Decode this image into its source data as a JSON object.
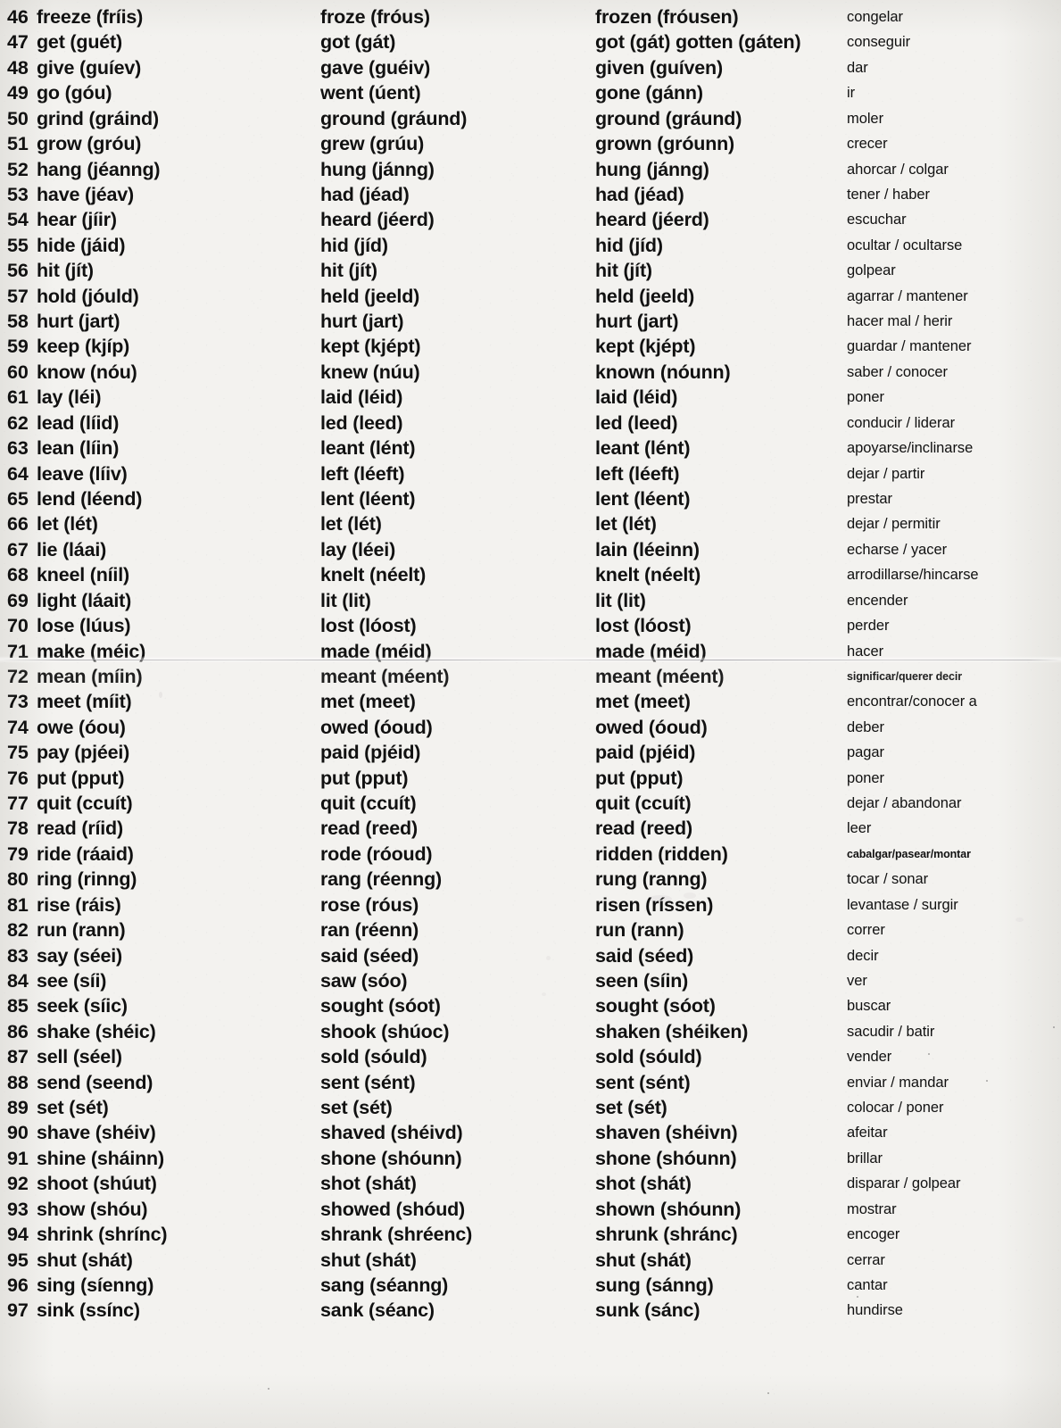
{
  "document": {
    "kind": "scanned-page",
    "title": "Irregular Verbs List (46-97)",
    "columns": [
      "infinitive",
      "past_simple",
      "past_participle",
      "spanish"
    ]
  },
  "rows": [
    {
      "n": "46",
      "inf": "freeze (fríis)",
      "past": "froze (fróus)",
      "part": "frozen (fróusen)",
      "es": "congelar"
    },
    {
      "n": "47",
      "inf": "get (guét)",
      "past": "got (gát)",
      "part": "got (gát) gotten (gáten)",
      "es": "conseguir"
    },
    {
      "n": "48",
      "inf": "give (guíev)",
      "past": "gave (guéiv)",
      "part": "given (guíven)",
      "es": "dar"
    },
    {
      "n": "49",
      "inf": "go (góu)",
      "past": "went (úent)",
      "part": "gone (gánn)",
      "es": "ir"
    },
    {
      "n": "50",
      "inf": "grind (gráind)",
      "past": "ground (gráund)",
      "part": "ground (gráund)",
      "es": "moler"
    },
    {
      "n": "51",
      "inf": "grow (gróu)",
      "past": "grew (grúu)",
      "part": "grown (gróunn)",
      "es": "crecer"
    },
    {
      "n": "52",
      "inf": "hang (jéanng)",
      "past": "hung (jánng)",
      "part": "hung (jánng)",
      "es": "ahorcar / colgar"
    },
    {
      "n": "53",
      "inf": "have (jéav)",
      "past": "had (jéad)",
      "part": "had (jéad)",
      "es": "tener / haber"
    },
    {
      "n": "54",
      "inf": "hear (jíir)",
      "past": "heard (jéerd)",
      "part": "heard (jéerd)",
      "es": "escuchar"
    },
    {
      "n": "55",
      "inf": "hide (jáid)",
      "past": "hid (jíd)",
      "part": "hid (jíd)",
      "es": "ocultar / ocultarse"
    },
    {
      "n": "56",
      "inf": "hit (jít)",
      "past": "hit (jít)",
      "part": "hit (jít)",
      "es": "golpear"
    },
    {
      "n": "57",
      "inf": "hold (jóuld)",
      "past": "held (jeeld)",
      "part": "held (jeeld)",
      "es": "agarrar / mantener"
    },
    {
      "n": "58",
      "inf": "hurt (jart)",
      "past": "hurt (jart)",
      "part": "hurt (jart)",
      "es": "hacer mal / herir"
    },
    {
      "n": "59",
      "inf": "keep (kjíp)",
      "past": "kept (kjépt)",
      "part": "kept (kjépt)",
      "es": "guardar / mantener"
    },
    {
      "n": "60",
      "inf": "know (nóu)",
      "past": "knew (núu)",
      "part": "known (nóunn)",
      "es": "saber / conocer"
    },
    {
      "n": "61",
      "inf": "lay (léi)",
      "past": "laid (léid)",
      "part": "laid (léid)",
      "es": "poner"
    },
    {
      "n": "62",
      "inf": "lead (líid)",
      "past": "led (leed)",
      "part": "led (leed)",
      "es": "conducir / liderar"
    },
    {
      "n": "63",
      "inf": "lean (líin)",
      "past": "leant (lént)",
      "part": "leant (lént)",
      "es": "apoyarse/inclinarse"
    },
    {
      "n": "64",
      "inf": "leave (líiv)",
      "past": "left (léeft)",
      "part": "left (léeft)",
      "es": "dejar / partir"
    },
    {
      "n": "65",
      "inf": "lend (léend)",
      "past": "lent (léent)",
      "part": "lent (léent)",
      "es": "prestar"
    },
    {
      "n": "66",
      "inf": "let (lét)",
      "past": "let (lét)",
      "part": "let (lét)",
      "es": "dejar / permitir"
    },
    {
      "n": "67",
      "inf": "lie (láai)",
      "past": "lay (léei)",
      "part": "lain (léeinn)",
      "es": "echarse / yacer"
    },
    {
      "n": "68",
      "inf": "kneel (níil)",
      "past": "knelt (néelt)",
      "part": "knelt (néelt)",
      "es": "arrodillarse/hincarse"
    },
    {
      "n": "69",
      "inf": "light (láait)",
      "past": "lit (lit)",
      "part": "lit (lit)",
      "es": "encender"
    },
    {
      "n": "70",
      "inf": "lose (lúus)",
      "past": "lost (lóost)",
      "part": "lost (lóost)",
      "es": "perder"
    },
    {
      "n": "71",
      "inf": "make (méic)",
      "past": "made (méid)",
      "part": "made (méid)",
      "es": "hacer"
    },
    {
      "n": "72",
      "inf": "mean (míin)",
      "past": "meant (méent)",
      "part": "meant (méent)",
      "es": "significar/querer decir",
      "es_size": "tiny"
    },
    {
      "n": "73",
      "inf": "meet (míit)",
      "past": "met (meet)",
      "part": "met (meet)",
      "es": "encontrar/conocer a"
    },
    {
      "n": "74",
      "inf": "owe (óou)",
      "past": "owed (óoud)",
      "part": "owed (óoud)",
      "es": "deber"
    },
    {
      "n": "75",
      "inf": "pay (pjéei)",
      "past": "paid (pjéid)",
      "part": "paid (pjéid)",
      "es": "pagar"
    },
    {
      "n": "76",
      "inf": "put (pput)",
      "past": "put (pput)",
      "part": "put (pput)",
      "es": "poner"
    },
    {
      "n": "77",
      "inf": "quit (ccuít)",
      "past": "quit (ccuít)",
      "part": "quit (ccuít)",
      "es": "dejar / abandonar"
    },
    {
      "n": "78",
      "inf": "read (ríid)",
      "past": "read (reed)",
      "part": "read (reed)",
      "es": "leer"
    },
    {
      "n": "79",
      "inf": "ride (ráaid)",
      "past": "rode (róoud)",
      "part": "ridden (ridden)",
      "es": "cabalgar/pasear/montar",
      "es_size": "tiny"
    },
    {
      "n": "80",
      "inf": "ring (rinng)",
      "past": "rang (réenng)",
      "part": "rung (ranng)",
      "es": "tocar / sonar"
    },
    {
      "n": "81",
      "inf": "rise (ráis)",
      "past": "rose (róus)",
      "part": "risen (ríssen)",
      "es": "levantase / surgir"
    },
    {
      "n": "82",
      "inf": "run (rann)",
      "past": "ran (réenn)",
      "part": "run (rann)",
      "es": "correr"
    },
    {
      "n": "83",
      "inf": "say (séei)",
      "past": "said (séed)",
      "part": "said (séed)",
      "es": "decir"
    },
    {
      "n": "84",
      "inf": "see (síi)",
      "past": "saw (sóo)",
      "part": "seen (síin)",
      "es": "ver"
    },
    {
      "n": "85",
      "inf": "seek (síic)",
      "past": "sought (sóot)",
      "part": "sought (sóot)",
      "es": "buscar"
    },
    {
      "n": "86",
      "inf": "shake (shéic)",
      "past": "shook (shúoc)",
      "part": "shaken (shéiken)",
      "es": "sacudir / batir"
    },
    {
      "n": "87",
      "inf": "sell (séel)",
      "past": "sold (sóuld)",
      "part": "sold (sóuld)",
      "es": "vender"
    },
    {
      "n": "88",
      "inf": "send (seend)",
      "past": "sent (sént)",
      "part": "sent (sént)",
      "es": "enviar / mandar"
    },
    {
      "n": "89",
      "inf": "set (sét)",
      "past": "set (sét)",
      "part": "set (sét)",
      "es": "colocar / poner"
    },
    {
      "n": "90",
      "inf": "shave (shéiv)",
      "past": "shaved (shéivd)",
      "part": "shaven (shéivn)",
      "es": "afeitar"
    },
    {
      "n": "91",
      "inf": "shine (sháinn)",
      "past": "shone (shóunn)",
      "part": "shone (shóunn)",
      "es": "brillar"
    },
    {
      "n": "92",
      "inf": "shoot (shúut)",
      "past": "shot (shát)",
      "part": "shot (shát)",
      "es": "disparar / golpear"
    },
    {
      "n": "93",
      "inf": "show (shóu)",
      "past": "showed (shóud)",
      "part": "shown (shóunn)",
      "es": "mostrar"
    },
    {
      "n": "94",
      "inf": "shrink (shrínc)",
      "past": "shrank (shréenc)",
      "part": "shrunk (shránc)",
      "es": "encoger"
    },
    {
      "n": "95",
      "inf": "shut (shát)",
      "past": "shut (shát)",
      "part": "shut (shát)",
      "es": "cerrar"
    },
    {
      "n": "96",
      "inf": "sing (síenng)",
      "past": "sang (séanng)",
      "part": "sung (sánng)",
      "es": "cantar"
    },
    {
      "n": "97",
      "inf": "sink (ssínc)",
      "past": "sank (séanc)",
      "part": "sunk (sánc)",
      "es": "hundirse"
    }
  ]
}
